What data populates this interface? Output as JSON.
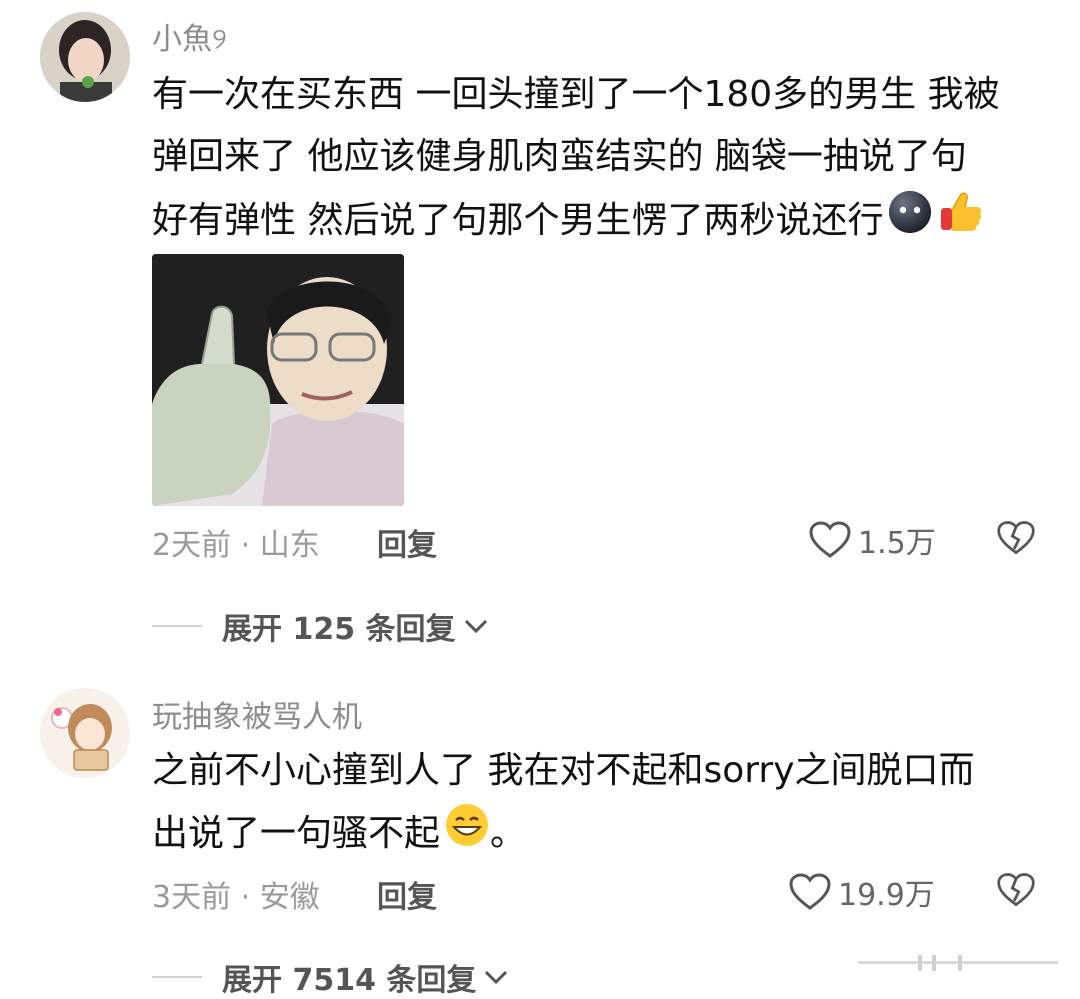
{
  "comments": [
    {
      "username": "小魚୨",
      "lines": [
        "有一次在买东西 一回头撞到了一个180多的男生 我被",
        "弹回来了 他应该健身肌肉蛮结实的 脑袋一抽说了句",
        "好有弹性 然后说了句那个男生愣了两秒说还行"
      ],
      "trailing_emojis": [
        "dark-face-emoji",
        "thumbs-up-emoji"
      ],
      "has_image": true,
      "meta": "2天前 · 山东",
      "reply_label": "回复",
      "likes": "1.5万",
      "expand_label": "展开 125 条回复"
    },
    {
      "username": "玩抽象被骂人机",
      "lines": [
        "之前不小心撞到人了 我在对不起和sorry之间脱口而",
        "出说了一句骚不起"
      ],
      "trailing_emojis": [
        "grinning-face-emoji"
      ],
      "tail_text": "。",
      "has_image": false,
      "meta": "3天前 · 安徽",
      "reply_label": "回复",
      "likes": "19.9万",
      "expand_label": "展开 7514 条回复"
    }
  ],
  "colors": {
    "username": "#8c8c8c",
    "body": "#111111",
    "meta": "#9a9a9a",
    "reply": "#555555"
  }
}
